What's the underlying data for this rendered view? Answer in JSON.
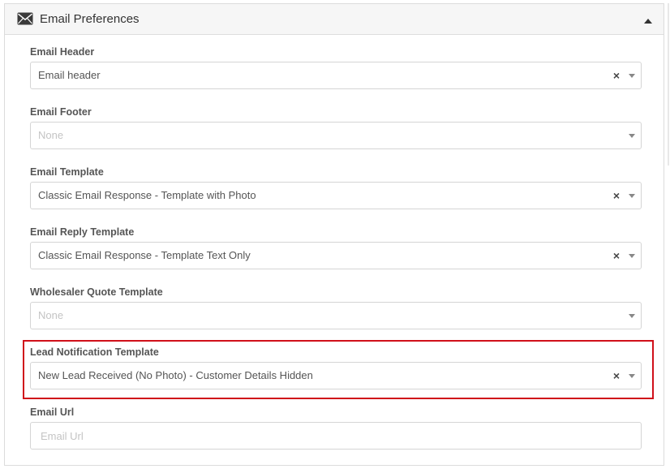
{
  "panel": {
    "title": "Email Preferences",
    "icon": "envelope-icon",
    "collapse_icon": "caret-up-icon"
  },
  "fields": {
    "email_header": {
      "label": "Email Header",
      "value": "Email header",
      "clearable": true
    },
    "email_footer": {
      "label": "Email Footer",
      "placeholder": "None",
      "clearable": false
    },
    "email_template": {
      "label": "Email Template",
      "value": "Classic Email Response - Template with Photo",
      "clearable": true
    },
    "email_reply_template": {
      "label": "Email Reply Template",
      "value": "Classic Email Response - Template Text Only",
      "clearable": true
    },
    "wholesaler_quote_template": {
      "label": "Wholesaler Quote Template",
      "placeholder": "None",
      "clearable": false
    },
    "lead_notification_template": {
      "label": "Lead Notification Template",
      "value": "New Lead Received (No Photo) - Customer Details Hidden",
      "clearable": true,
      "highlighted": true
    },
    "email_url": {
      "label": "Email Url",
      "placeholder": "Email Url",
      "value": ""
    }
  },
  "controls": {
    "clear_glyph": "×"
  },
  "colors": {
    "highlight": "#d0101a",
    "label": "#555555",
    "placeholder": "#c4c4c4",
    "header_bg": "#f6f6f6",
    "border": "#d5d5d5"
  }
}
